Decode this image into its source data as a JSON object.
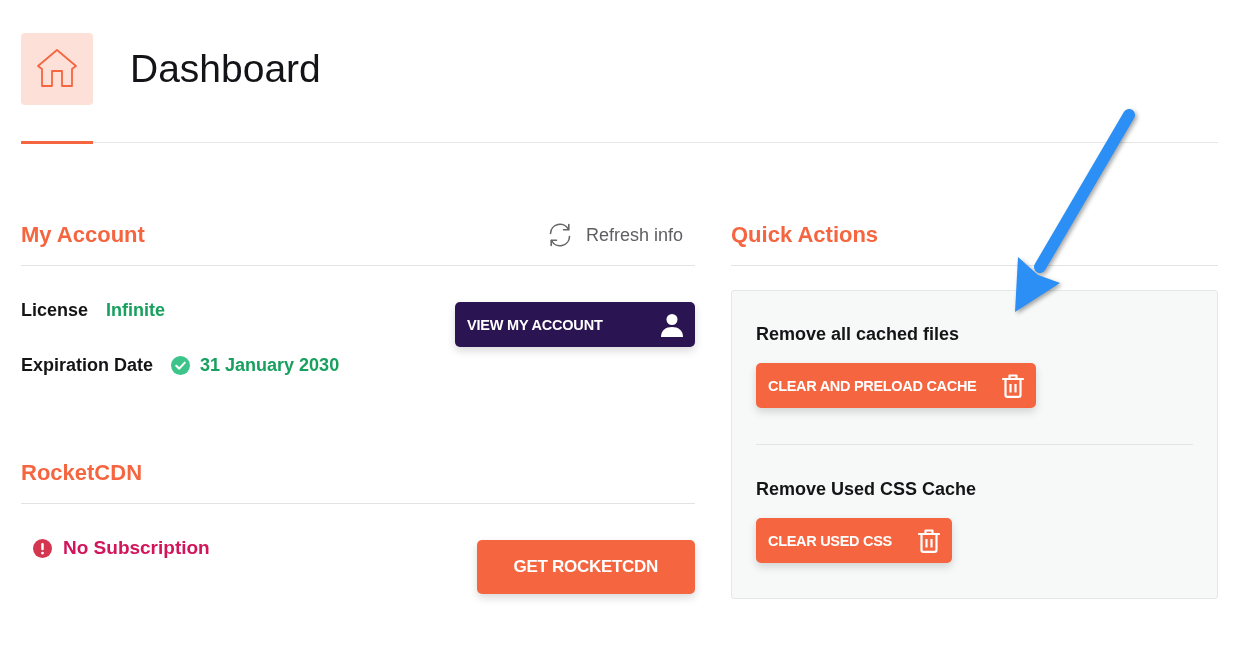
{
  "header": {
    "title": "Dashboard"
  },
  "my_account": {
    "title": "My Account",
    "refresh_link": "Refresh info",
    "fields": [
      {
        "label": "License",
        "value": "Infinite",
        "kind": "plain"
      },
      {
        "label": "Expiration Date",
        "value": "31 January 2030",
        "kind": "verified"
      }
    ],
    "button": "VIEW MY ACCOUNT"
  },
  "rocketcdn": {
    "title": "RocketCDN",
    "status": "No Subscription",
    "button": "GET ROCKETCDN"
  },
  "quick_actions": {
    "title": "Quick Actions",
    "actions": [
      {
        "label": "Remove all cached files",
        "button": "CLEAR AND PRELOAD CACHE"
      },
      {
        "label": "Remove Used CSS Cache",
        "button": "CLEAR USED CSS"
      }
    ]
  }
}
